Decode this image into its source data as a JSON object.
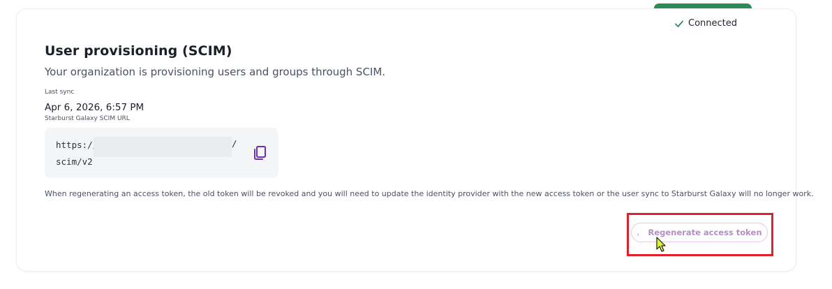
{
  "status": {
    "label": "Connected",
    "icon": "check-icon",
    "color": "#2e8b57"
  },
  "scim": {
    "title": "User provisioning (SCIM)",
    "subtitle": "Your organization is provisioning users and groups through SCIM.",
    "last_sync_label": "Last sync",
    "last_sync_value": "Apr 6, 2026, 6:57 PM",
    "url_label": "Starburst Galaxy SCIM URL",
    "url_prefix": "https://",
    "url_slash": "/",
    "url_suffix": "scim/v2",
    "copy_icon": "copy-icon",
    "notice": "When regenerating an access token, the old token will be revoked and you will need to update the identity provider with the new access token or the user sync to Starburst Galaxy will no longer work.",
    "regenerate_label": "Regenerate access token"
  },
  "colors": {
    "accent": "#6b2fb3",
    "button_text": "#b68ec6",
    "highlight": "#e0202b"
  }
}
